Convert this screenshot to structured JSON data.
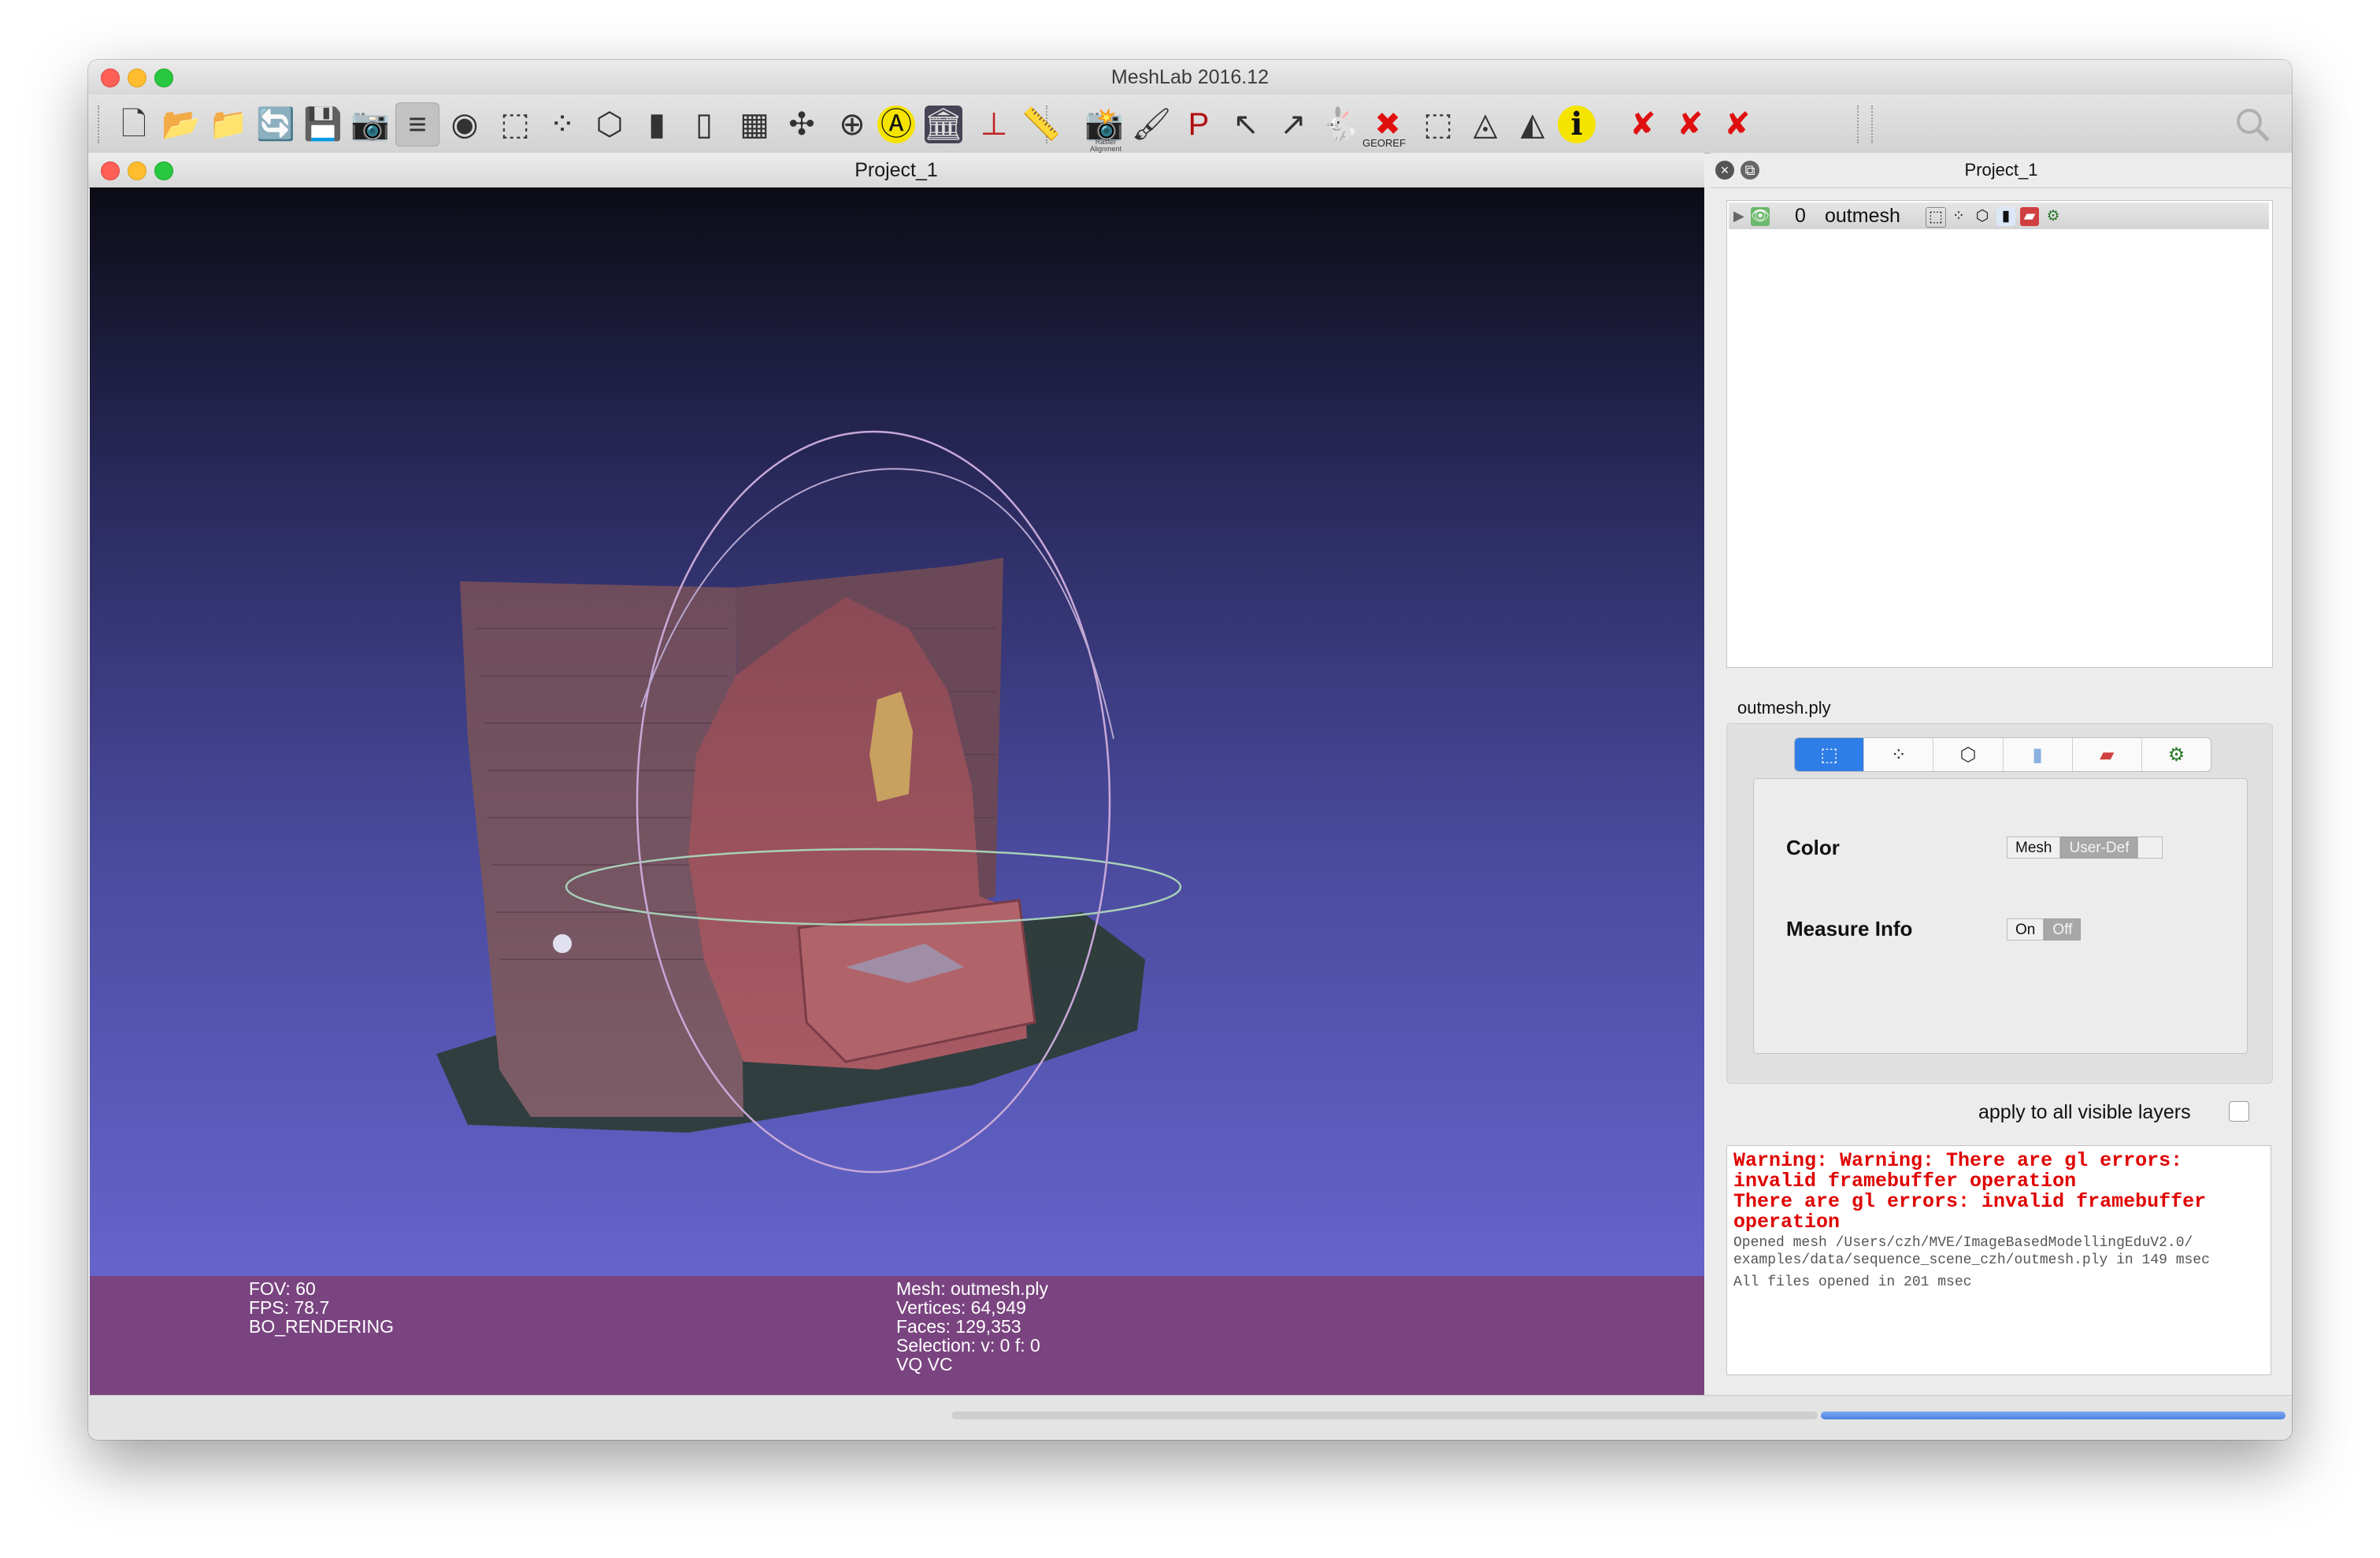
{
  "window": {
    "title": "MeshLab 2016.12"
  },
  "toolbar": {
    "items": [
      {
        "name": "new-project-icon",
        "glyph": "🗋"
      },
      {
        "name": "open-project-icon",
        "glyph": "📂"
      },
      {
        "name": "import-mesh-icon",
        "glyph": "📁"
      },
      {
        "name": "reload-icon",
        "glyph": "🔄"
      },
      {
        "name": "export-mesh-icon",
        "glyph": "💾"
      },
      {
        "name": "snapshot-icon",
        "glyph": "📷"
      },
      {
        "name": "layers-icon",
        "glyph": "≡"
      },
      {
        "name": "raster-view-icon",
        "glyph": "◉"
      },
      {
        "name": "bbox-render-icon",
        "glyph": "⬚"
      },
      {
        "name": "points-render-icon",
        "glyph": "⁘"
      },
      {
        "name": "wireframe-render-icon",
        "glyph": "⬡"
      },
      {
        "name": "smooth-render-icon",
        "glyph": "▮"
      },
      {
        "name": "flat-render-icon",
        "glyph": "▯"
      },
      {
        "name": "grid-icon",
        "glyph": "▦"
      },
      {
        "name": "axes-icon",
        "glyph": "✣"
      },
      {
        "name": "trackball-icon",
        "glyph": "⊕"
      },
      {
        "name": "align-icon",
        "glyph": "Ⓐ"
      },
      {
        "name": "texture-icon",
        "glyph": "🏛"
      },
      {
        "name": "manipulator-icon",
        "glyph": "⊥"
      },
      {
        "name": "measure-icon",
        "glyph": "📏"
      },
      {
        "name": "raster-align-icon",
        "glyph": "📸"
      },
      {
        "name": "paint-icon",
        "glyph": "🖌"
      },
      {
        "name": "pickpoints-icon",
        "glyph": "P"
      },
      {
        "name": "select-vertices-icon",
        "glyph": "↖"
      },
      {
        "name": "select-faces-icon",
        "glyph": "↗"
      },
      {
        "name": "bunny-icon",
        "glyph": "🐇"
      },
      {
        "name": "georef-icon",
        "glyph": "✖"
      },
      {
        "name": "select-rect-icon",
        "glyph": "⬚"
      },
      {
        "name": "select-connected-icon",
        "glyph": "◬"
      },
      {
        "name": "select-region-icon",
        "glyph": "◭"
      },
      {
        "name": "info-icon",
        "glyph": "ℹ"
      },
      {
        "name": "delete-vertices-icon",
        "glyph": "✘"
      },
      {
        "name": "delete-faces-icon",
        "glyph": "✘"
      },
      {
        "name": "delete-selected-icon",
        "glyph": "✘"
      }
    ],
    "georef_label": "GEOREF",
    "raster_label": "Raster Alignment"
  },
  "subwindow": {
    "title": "Project_1"
  },
  "viewport": {
    "left_info": [
      "FOV: 60",
      "FPS:    78.7",
      "BO_RENDERING"
    ],
    "right_info": [
      "Mesh: outmesh.ply",
      "Vertices: 64,949",
      "Faces: 129,353",
      "Selection: v: 0 f: 0",
      "VQ VC"
    ]
  },
  "right_panel": {
    "title": "Project_1",
    "layer": {
      "index": "0",
      "name": "outmesh"
    },
    "render_label": "outmesh.ply",
    "tab_icons": [
      "cube-icon",
      "points-icon",
      "wireframe-icon",
      "cylinder-icon",
      "texture-icon",
      "options-icon"
    ],
    "color_label": "Color",
    "color_options": [
      "Mesh",
      "User-Def"
    ],
    "measure_label": "Measure Info",
    "measure_options": [
      "On",
      "Off"
    ],
    "apply_label": "apply to all visible layers"
  },
  "log": {
    "warnings": [
      "Warning: Warning: There are gl errors:",
      "invalid framebuffer operation",
      "There are gl errors: invalid framebuffer",
      "operation"
    ],
    "info": [
      "Opened mesh /Users/czh/MVE/ImageBasedModellingEduV2.0/",
      "examples/data/sequence_scene_czh/outmesh.ply in 149 msec",
      "All files opened in 201 msec"
    ]
  },
  "colors": {
    "accent": "#2f7de6",
    "info_bar": "#7a4480",
    "warning": "#e00000"
  }
}
